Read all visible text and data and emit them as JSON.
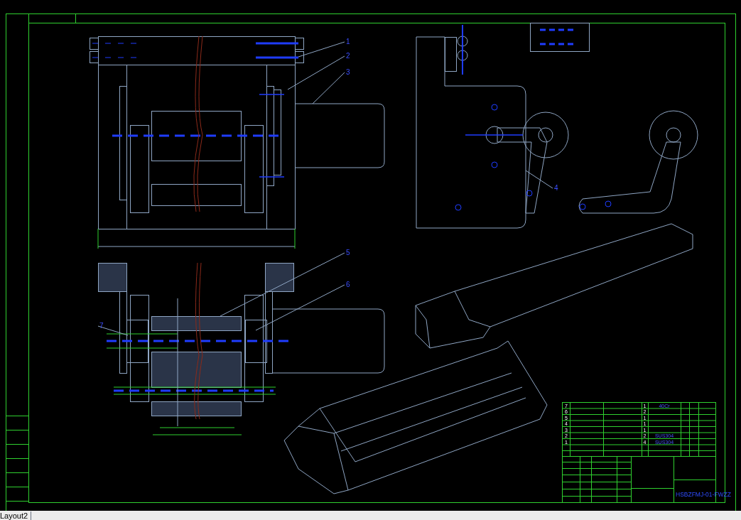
{
  "drawing": {
    "balloons": [
      {
        "label": "1"
      },
      {
        "label": "2"
      },
      {
        "label": "3"
      },
      {
        "label": "4"
      },
      {
        "label": "5"
      },
      {
        "label": "6"
      },
      {
        "label": "7"
      }
    ],
    "parts_list": [
      {
        "no": "7",
        "qty": "1",
        "material": "40Cr"
      },
      {
        "no": "6",
        "qty": "2"
      },
      {
        "no": "5",
        "qty": "1"
      },
      {
        "no": "4",
        "qty": "1"
      },
      {
        "no": "3",
        "qty": "1"
      },
      {
        "no": "2",
        "qty": "2",
        "material": "SUS304"
      },
      {
        "no": "1",
        "qty": "4",
        "material": "SUS304"
      }
    ],
    "drawing_number": "HSBZFMJ-01-FWZZ"
  },
  "status_bar": {
    "layout_tab": "Layout2"
  }
}
